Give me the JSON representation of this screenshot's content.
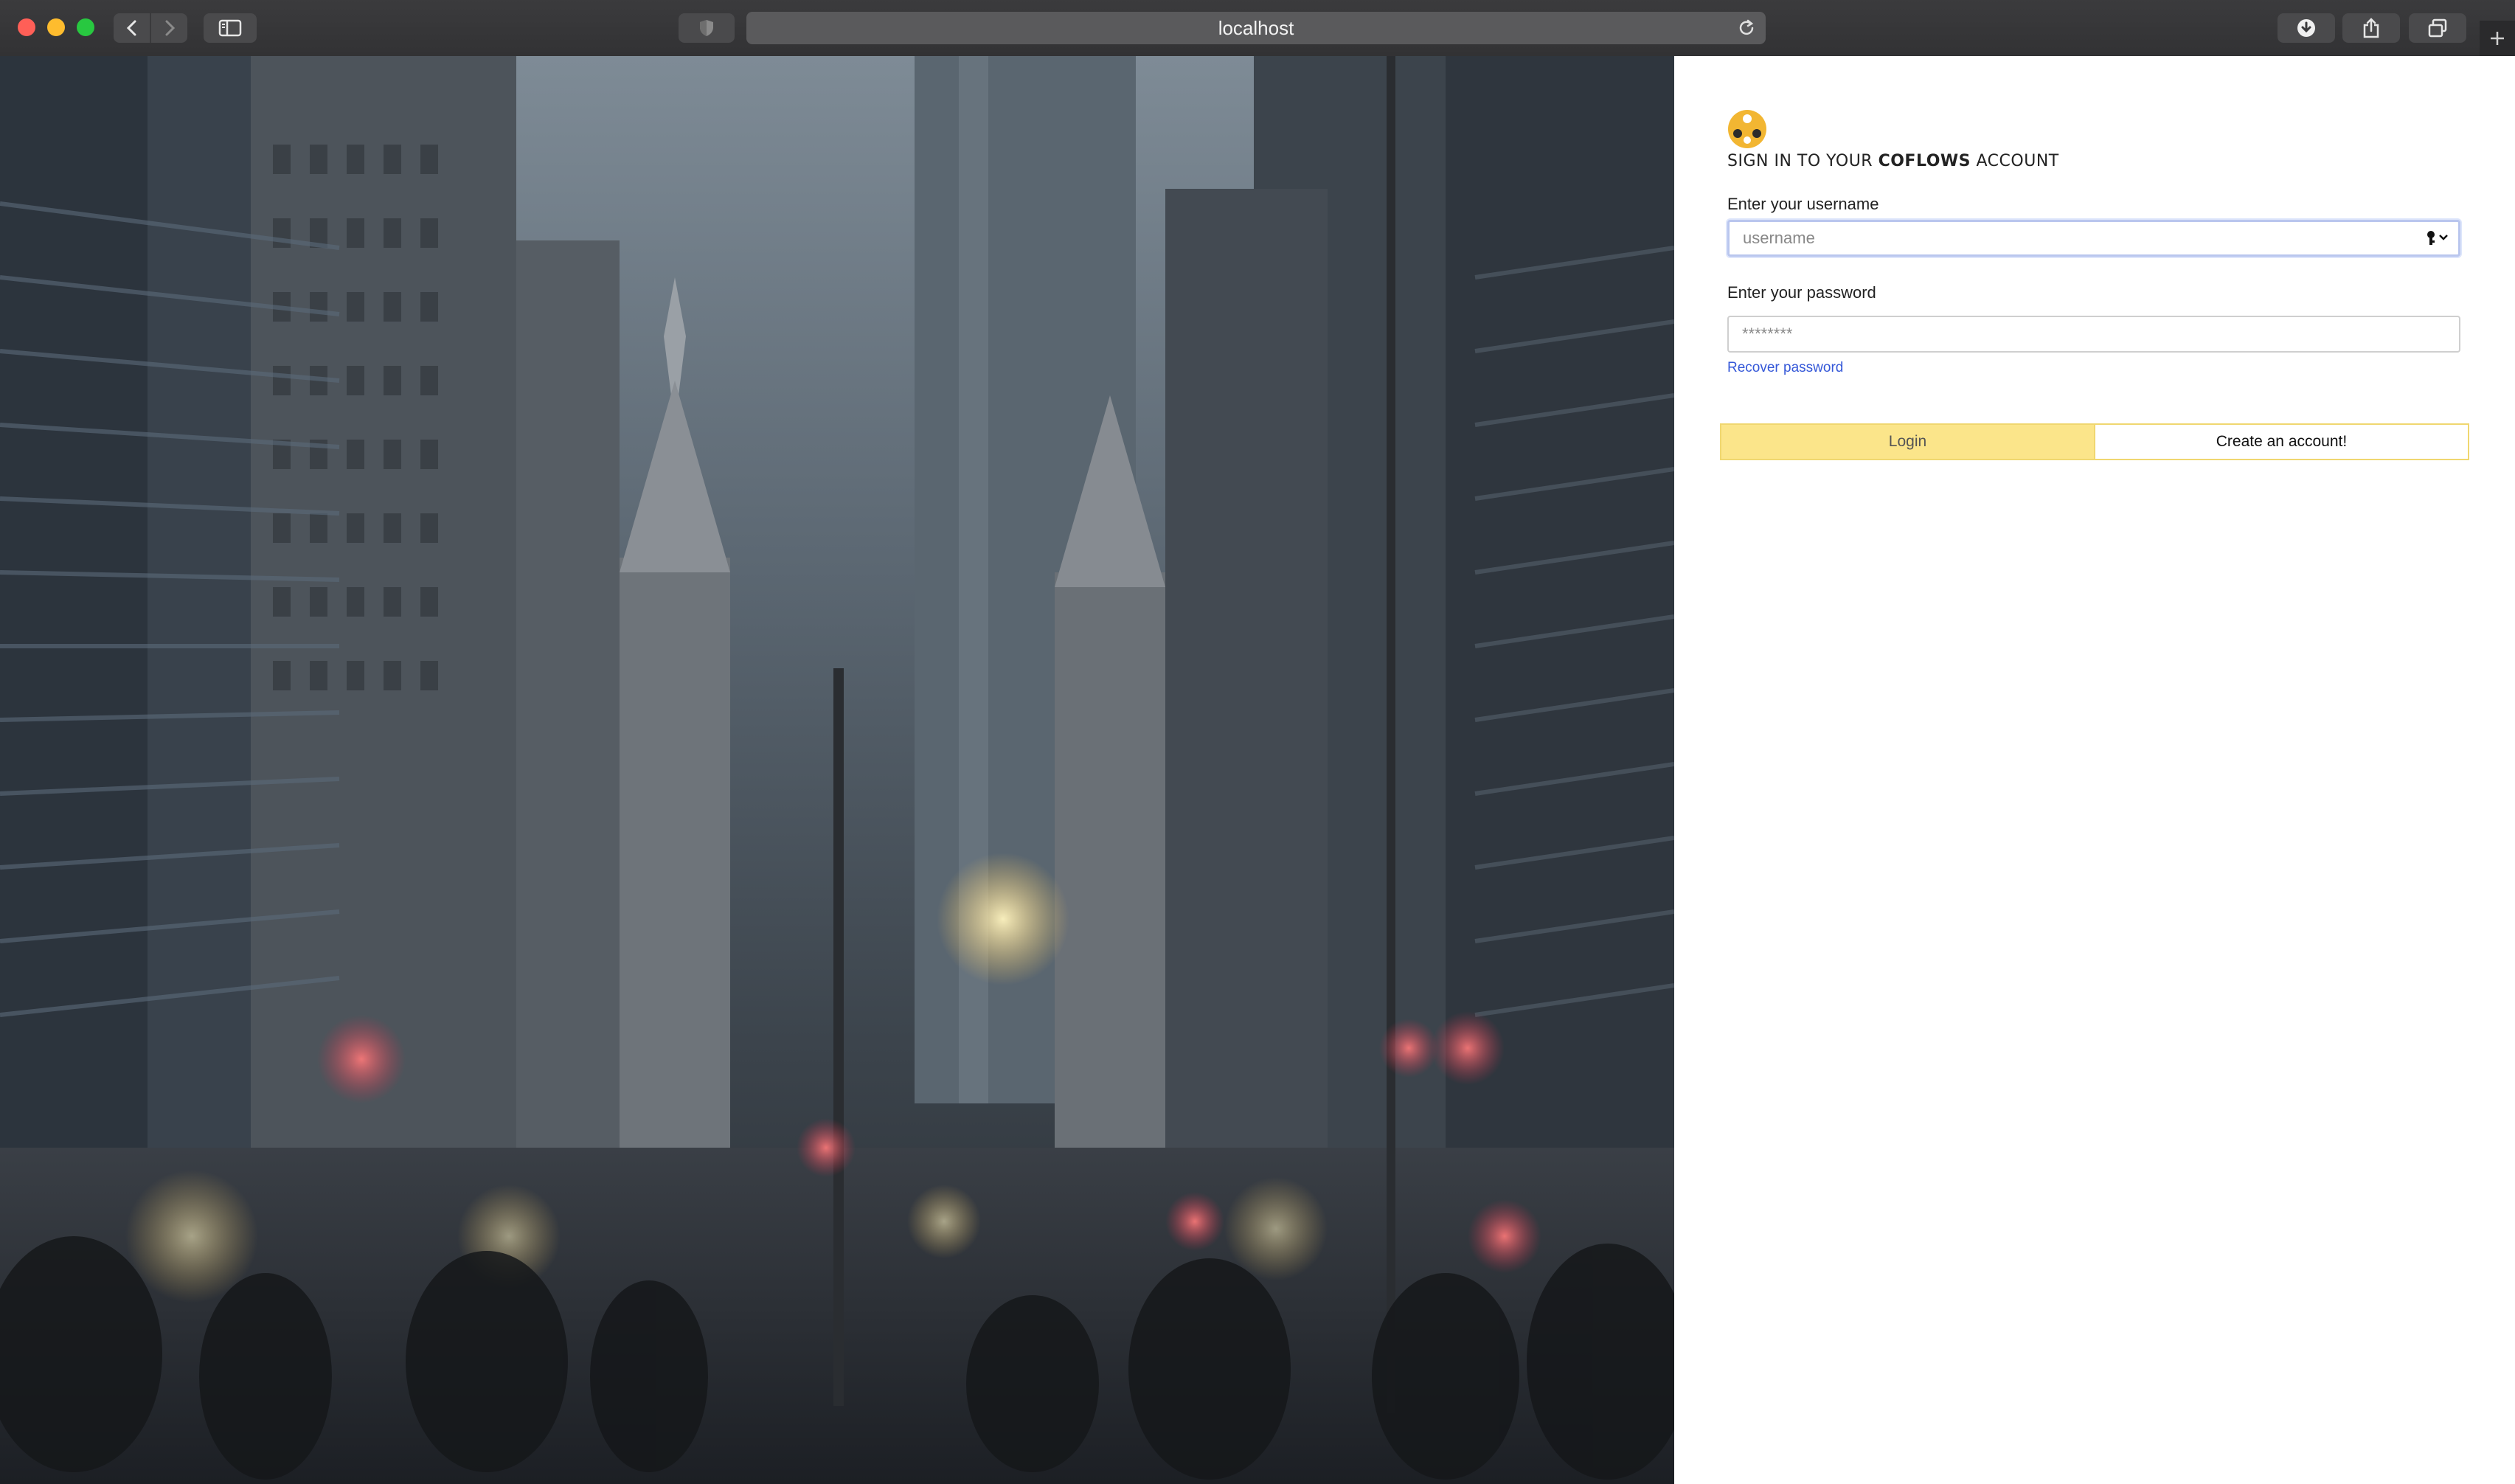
{
  "browser": {
    "url": "localhost"
  },
  "login": {
    "heading_prefix": "SIGN IN TO YOUR ",
    "heading_brand": "COFLOWS",
    "heading_suffix": " ACCOUNT",
    "username_label": "Enter your username",
    "username_placeholder": "username",
    "password_label": "Enter your password",
    "password_value": "********",
    "recover_link": "Recover password",
    "login_button": "Login",
    "create_button": "Create an account!"
  },
  "colors": {
    "accent_yellow": "#fbe58a",
    "link_blue": "#3558d8",
    "logo_orange": "#f2b632"
  }
}
